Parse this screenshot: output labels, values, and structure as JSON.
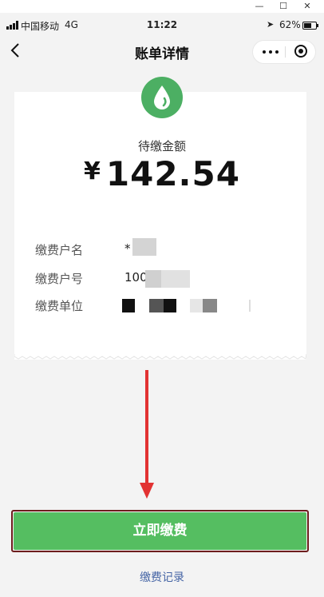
{
  "window": {
    "minimize": "—",
    "maximize": "☐",
    "close": "✕"
  },
  "status_bar": {
    "carrier": "中国移动",
    "network": "4G",
    "time": "11:22",
    "battery": "62%",
    "battery_level": 0.62
  },
  "nav": {
    "title": "账单详情"
  },
  "bill": {
    "amount_label": "待缴金额",
    "currency": "¥",
    "amount": "142.54",
    "rows": [
      {
        "label": "缴费户名",
        "value": "*"
      },
      {
        "label": "缴费户号",
        "value": "100"
      },
      {
        "label": "缴费单位",
        "value": ""
      }
    ]
  },
  "actions": {
    "pay_label": "立即缴费",
    "history_label": "缴费记录"
  },
  "colors": {
    "primary_green": "#55be61",
    "icon_green": "#4caf63",
    "link_blue": "#4766a6",
    "annotation_red": "#e23232"
  }
}
